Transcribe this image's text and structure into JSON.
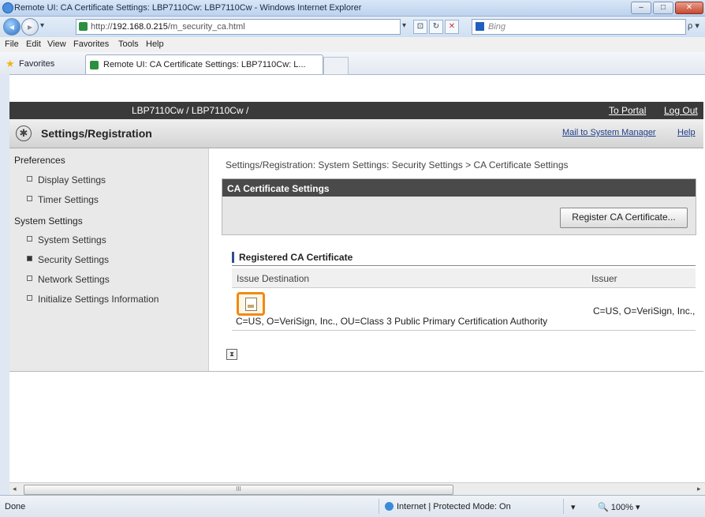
{
  "window": {
    "title": "Remote UI: CA Certificate Settings: LBP7110Cw: LBP7110Cw - Windows Internet Explorer",
    "min": "–",
    "max": "□",
    "close": "✕"
  },
  "nav": {
    "url_prefix": "http://",
    "url_host": "192.168.0.215",
    "url_path": "/m_security_ca.html",
    "search_placeholder": "Bing",
    "search_go": "ρ ▾",
    "dropdown": "▾",
    "compat_icon": "⊡",
    "refresh_icon": "↻",
    "stop_icon": "✕"
  },
  "menu": [
    "File",
    "Edit",
    "View",
    "Favorites",
    "Tools",
    "Help"
  ],
  "favorites": {
    "label": "Favorites",
    "tab_title": "Remote UI: CA Certificate Settings: LBP7110Cw: L..."
  },
  "header": {
    "model": "LBP7110Cw / LBP7110Cw /",
    "to_portal": "To Portal",
    "log_out": "Log Out"
  },
  "settings_header": {
    "title": "Settings/Registration",
    "mail": "Mail to System Manager",
    "help": "Help"
  },
  "sidebar": {
    "preferences": "Preferences",
    "pref_items": [
      "Display Settings",
      "Timer Settings"
    ],
    "system_settings": "System Settings",
    "sys_items": [
      "System Settings",
      "Security Settings",
      "Network Settings",
      "Initialize Settings Information"
    ],
    "active": "Security Settings"
  },
  "main": {
    "breadcrumb": "Settings/Registration: System Settings: Security Settings > CA Certificate Settings",
    "panel_title": "CA Certificate Settings",
    "register_button": "Register CA Certificate...",
    "registered_title": "Registered CA Certificate",
    "col_issue_destination": "Issue Destination",
    "col_issuer": "Issuer",
    "cert_destination": "C=US, O=VeriSign, Inc., OU=Class 3 Public Primary Certification Authority",
    "cert_issuer": "C=US, O=VeriSign, Inc.,",
    "top_icon": "⧗"
  },
  "scrollbar": {
    "left": "◂",
    "right": "▸",
    "grip": "III"
  },
  "status": {
    "done": "Done",
    "zone": "Internet | Protected Mode: On",
    "zoom": "100%",
    "zoom_icon": "🔍",
    "security_icon": "▾"
  }
}
